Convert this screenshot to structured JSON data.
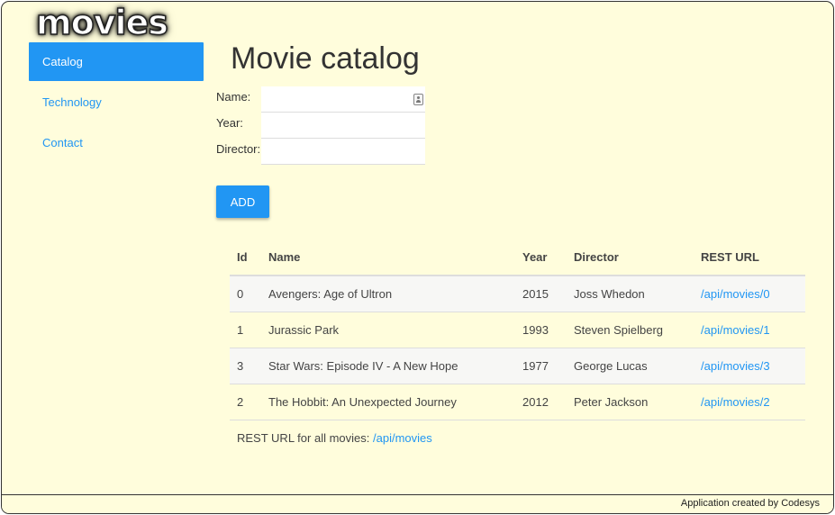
{
  "logo": {
    "text": "movies"
  },
  "sidebar": {
    "items": [
      {
        "label": "Catalog",
        "active": true
      },
      {
        "label": "Technology",
        "active": false
      },
      {
        "label": "Contact",
        "active": false
      }
    ]
  },
  "main": {
    "title": "Movie catalog",
    "form": {
      "name_label": "Name:",
      "name_value": "",
      "year_label": "Year:",
      "year_value": "",
      "director_label": "Director:",
      "director_value": "",
      "add_label": "ADD"
    },
    "table": {
      "headers": [
        "Id",
        "Name",
        "Year",
        "Director",
        "REST URL"
      ],
      "rows": [
        [
          "0",
          "Avengers: Age of Ultron",
          "2015",
          "Joss Whedon",
          "/api/movies/0"
        ],
        [
          "1",
          "Jurassic Park",
          "1993",
          "Steven Spielberg",
          "/api/movies/1"
        ],
        [
          "3",
          "Star Wars: Episode IV - A New Hope",
          "1977",
          "George Lucas",
          "/api/movies/3"
        ],
        [
          "2",
          "The Hobbit: An Unexpected Journey",
          "2012",
          "Peter Jackson",
          "/api/movies/2"
        ]
      ]
    },
    "rest_all": {
      "prefix": "REST URL for all movies: ",
      "link": "/api/movies"
    }
  },
  "footer": {
    "text": "Application created by Codesys"
  },
  "colors": {
    "accent": "#2196f3",
    "background": "#fffddc"
  }
}
